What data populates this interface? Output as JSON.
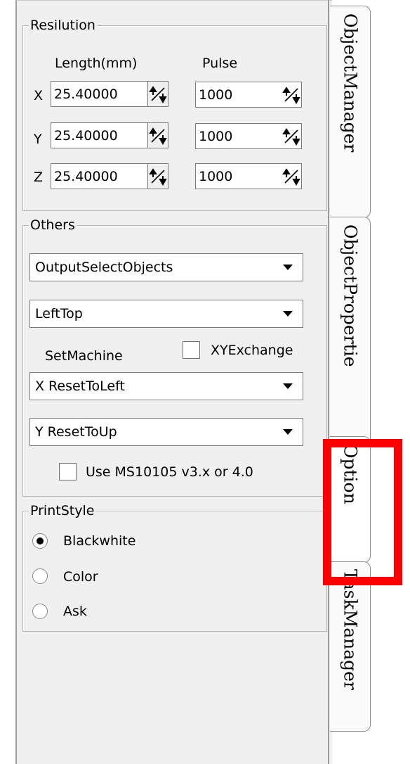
{
  "resolution": {
    "title": "Resilution",
    "col_length": "Length(mm)",
    "col_pulse": "Pulse",
    "rows": [
      {
        "axis": "X",
        "length": "25.40000",
        "pulse": "1000"
      },
      {
        "axis": "Y",
        "length": "25.40000",
        "pulse": "1000"
      },
      {
        "axis": "Z",
        "length": "25.40000",
        "pulse": "1000"
      }
    ]
  },
  "others": {
    "title": "Others",
    "output_select": "OutputSelectObjects",
    "origin_select": "LeftTop",
    "set_machine_label": "SetMachine",
    "xy_exchange_label": "XYExchange",
    "xy_exchange_checked": false,
    "x_reset_select": "X ResetToLeft",
    "y_reset_select": "Y ResetToUp",
    "use_ms_label": "Use MS10105 v3.x or 4.0",
    "use_ms_checked": false
  },
  "print_style": {
    "title": "PrintStyle",
    "options": [
      "Blackwhite",
      "Color",
      "Ask"
    ],
    "selected": "Blackwhite"
  },
  "tabs": [
    "ObjectManager",
    "ObjectPropertie",
    "Option",
    "TaskManager"
  ],
  "active_tab": "Option",
  "colors": {
    "highlight": "#ff0000",
    "panel": "#f0f0f0"
  }
}
